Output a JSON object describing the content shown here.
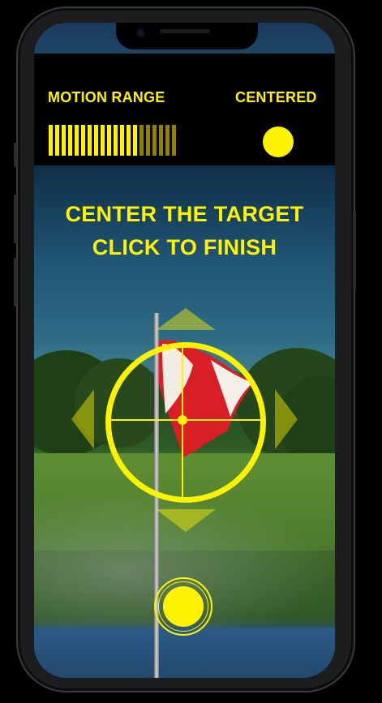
{
  "header": {
    "motion_range_label": "MOTION RANGE",
    "centered_label": "CENTERED"
  },
  "motion_range": {
    "segments_total": 20,
    "segments_lit": 14,
    "lit_color": "#fff200",
    "dim_color": "#8a8200"
  },
  "centered": {
    "state": true,
    "color": "#fff200"
  },
  "instructions": {
    "line1": "CENTER THE TARGET",
    "line2": "CLICK TO FINISH"
  },
  "icons": {
    "arrow_up": "arrow-up-icon",
    "arrow_down": "arrow-down-icon",
    "arrow_left": "arrow-left-icon",
    "arrow_right": "arrow-right-icon",
    "reticle": "crosshair-icon",
    "finish": "shutter-button"
  },
  "colors": {
    "accent": "#fff200",
    "arrow_fill": "rgba(255,242,0,0.45)"
  }
}
